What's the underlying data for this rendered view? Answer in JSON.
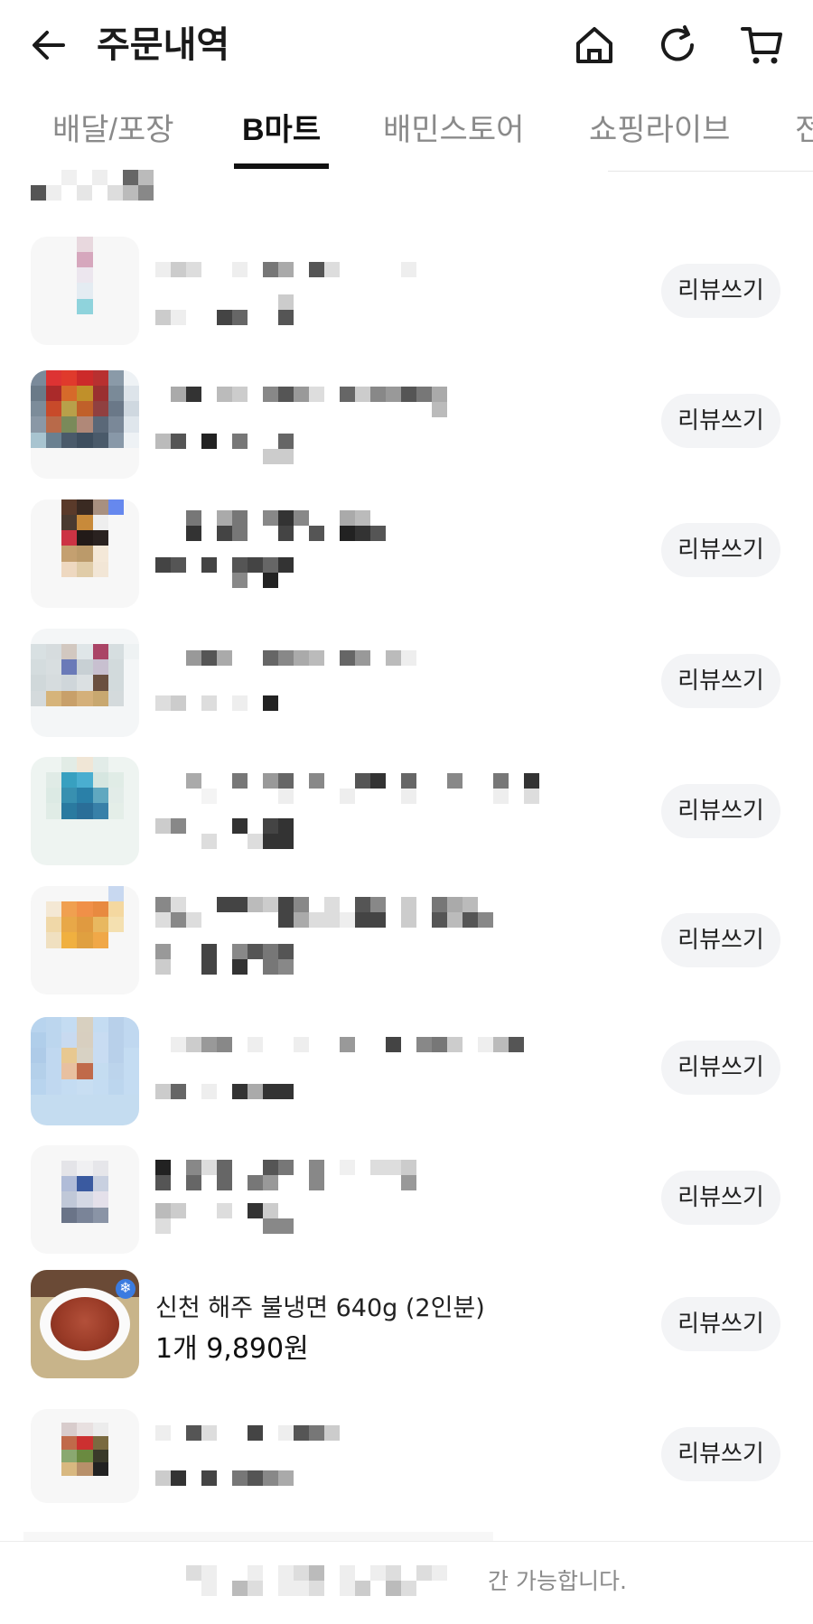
{
  "header": {
    "title": "주문내역"
  },
  "tabs": [
    {
      "label": "배달/포장",
      "active": false
    },
    {
      "label": "B마트",
      "active": true
    },
    {
      "label": "배민스토어",
      "active": false
    },
    {
      "label": "쇼핑라이브",
      "active": false
    },
    {
      "label": "전",
      "active": false
    }
  ],
  "items": [
    {
      "name": "",
      "price": "",
      "review_label": "리뷰쓰기"
    },
    {
      "name": "",
      "price": "",
      "review_label": "리뷰쓰기"
    },
    {
      "name": "",
      "price": "",
      "review_label": "리뷰쓰기"
    },
    {
      "name": "",
      "price": "",
      "review_label": "리뷰쓰기"
    },
    {
      "name": "",
      "price": "",
      "review_label": "리뷰쓰기"
    },
    {
      "name": "",
      "price": "",
      "review_label": "리뷰쓰기"
    },
    {
      "name": "",
      "price": "",
      "review_label": "리뷰쓰기"
    },
    {
      "name": "",
      "price": "",
      "review_label": "리뷰쓰기"
    },
    {
      "name": "신천 해주 불냉면 640g (2인분)",
      "price": "1개 9,890원",
      "review_label": "리뷰쓰기"
    },
    {
      "name": "",
      "price": "",
      "review_label": "리뷰쓰기"
    }
  ],
  "footer": {
    "notice_visible": "간 가능합니다."
  },
  "colors": {
    "accent_text": "#111111",
    "muted_text": "#8a8a8a",
    "button_bg": "#f3f4f6"
  },
  "icons": [
    "back-arrow-icon",
    "home-icon",
    "refresh-icon",
    "cart-icon",
    "frozen-badge-icon"
  ]
}
